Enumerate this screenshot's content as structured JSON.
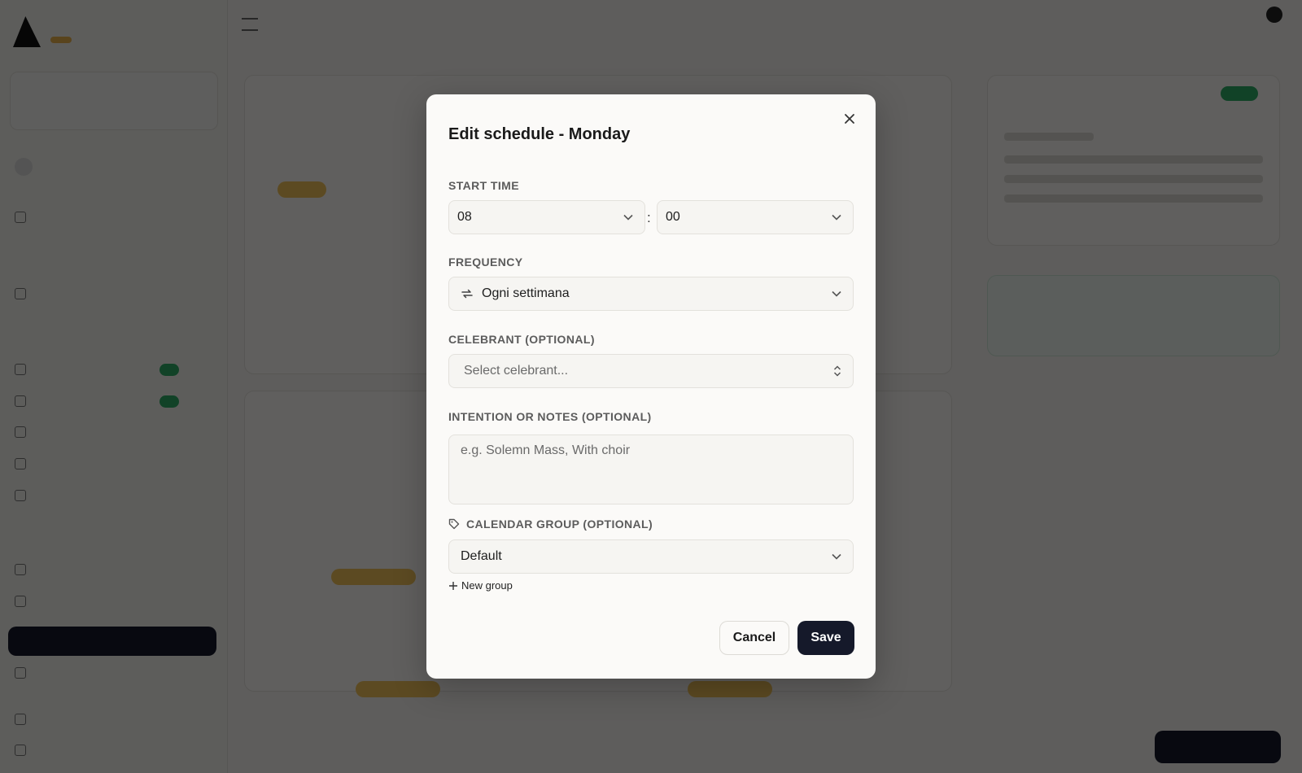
{
  "dialog": {
    "title": "Edit schedule - Monday",
    "close_icon": "close-icon",
    "start_time": {
      "label": "START TIME",
      "hour": "08",
      "minute": "00",
      "separator": ":"
    },
    "frequency": {
      "label": "FREQUENCY",
      "value": "Ogni settimana",
      "icon": "repeat-icon"
    },
    "celebrant": {
      "label": "CELEBRANT (OPTIONAL)",
      "placeholder": "Select celebrant..."
    },
    "notes": {
      "label": "INTENTION OR NOTES (OPTIONAL)",
      "placeholder": "e.g. Solemn Mass, With choir"
    },
    "calendar_group": {
      "label": "CALENDAR GROUP (OPTIONAL)",
      "value": "Default",
      "icon": "tag-icon"
    },
    "new_group_label": "New group",
    "cancel_label": "Cancel",
    "save_label": "Save"
  },
  "colors": {
    "overlay": "#000000",
    "primary_button": "#15192a",
    "badge_green": "#2fae66",
    "badge_amber": "#f1c35b"
  }
}
